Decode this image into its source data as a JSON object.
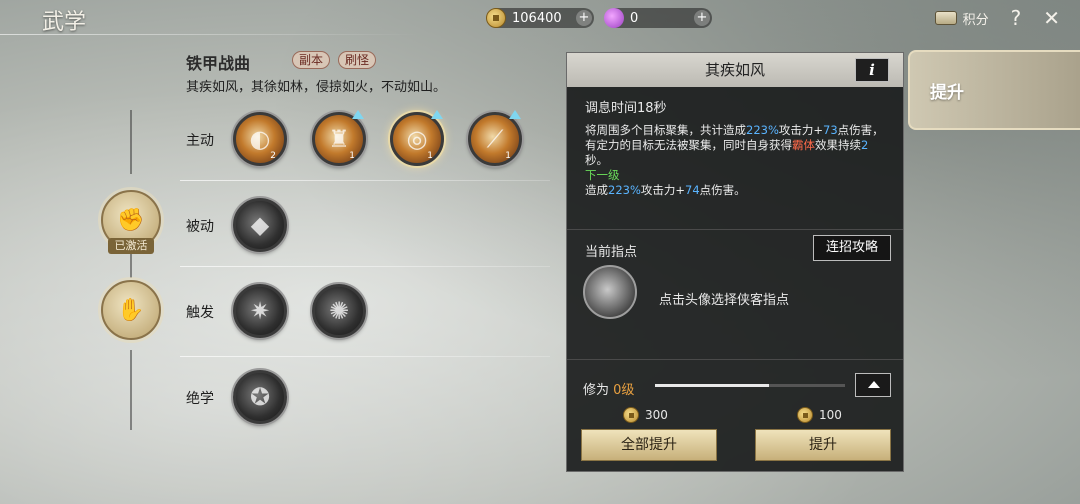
{
  "header": {
    "title": "武学",
    "coins": "106400",
    "gems": "0",
    "points_label": "积分",
    "help_glyph": "?",
    "close_glyph": "✕"
  },
  "skillset": {
    "name": "铁甲战曲",
    "tags": [
      "副本",
      "刷怪"
    ],
    "description": "其疾如风，其徐如林，侵掠如火，不动如山。"
  },
  "rows": {
    "active_label": "主动",
    "passive_label": "被动",
    "trigger_label": "触发",
    "ultimate_label": "绝学"
  },
  "badges": {
    "activated_label": "已激活"
  },
  "active_skills": [
    {
      "level": "2",
      "upgradable": false
    },
    {
      "level": "1",
      "upgradable": true
    },
    {
      "level": "1",
      "upgradable": true
    },
    {
      "level": "1",
      "upgradable": true
    }
  ],
  "panel": {
    "title": "其疾如风",
    "info_glyph": "i",
    "cooldown": "调息时间18秒",
    "desc_1": "将周围多个目标聚集，共计造成",
    "desc_pct": "223%",
    "desc_2": "攻击力+",
    "desc_flat": "73",
    "desc_3": "点伤害，有定力的目标无法被聚集，同时自身获得",
    "desc_status": "霸体",
    "desc_4": "效果持续",
    "desc_dur": "2",
    "desc_5": "秒。",
    "next_label": "下一级",
    "next_1": "造成",
    "next_pct": "223%",
    "next_2": "攻击力+",
    "next_flat": "74",
    "next_3": "点伤害。",
    "guide_label": "当前指点",
    "combo_button": "连招攻略",
    "guide_hint": "点击头像选择侠客指点",
    "cultivation_label": "修为",
    "cultivation_value": "0级",
    "cultivation_progress": 0.6,
    "cost_all": "300",
    "cost_one": "100",
    "upgrade_all_button": "全部提升",
    "upgrade_button": "提升"
  },
  "side_tab": {
    "label": "提升"
  },
  "colors": {
    "accent_blue": "#5ab4ff",
    "accent_red": "#ff6a4a",
    "accent_green": "#6adc5a",
    "cultivation_orange": "#e8a040"
  }
}
